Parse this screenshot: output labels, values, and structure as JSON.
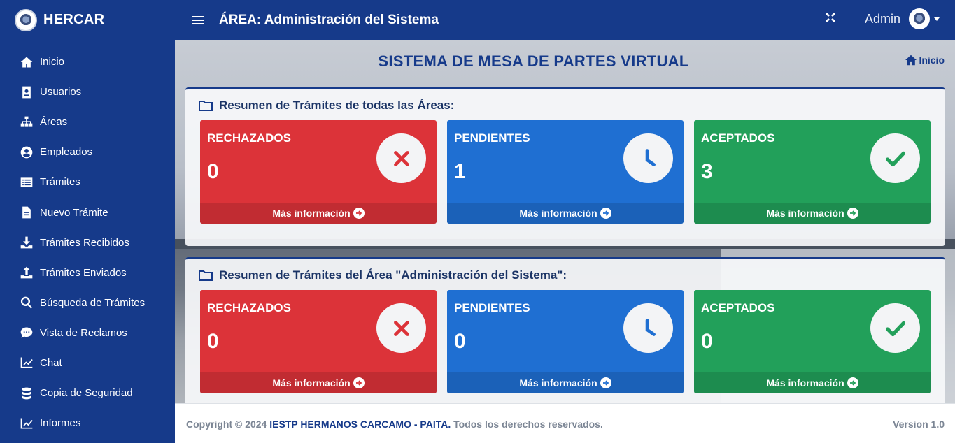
{
  "brand": {
    "name": "HERCAR"
  },
  "sidebar": {
    "items": [
      {
        "label": "Inicio",
        "icon": "home-icon"
      },
      {
        "label": "Usuarios",
        "icon": "id-badge-icon"
      },
      {
        "label": "Áreas",
        "icon": "sitemap-icon"
      },
      {
        "label": "Empleados",
        "icon": "user-circle-icon"
      },
      {
        "label": "Trámites",
        "icon": "list-icon"
      },
      {
        "label": "Nuevo Trámite",
        "icon": "file-icon"
      },
      {
        "label": "Trámites Recibidos",
        "icon": "download-icon"
      },
      {
        "label": "Trámites Enviados",
        "icon": "upload-icon"
      },
      {
        "label": "Búsqueda de Trámites",
        "icon": "search-icon"
      },
      {
        "label": "Vista de Reclamos",
        "icon": "comment-icon"
      },
      {
        "label": "Chat",
        "icon": "chart-line-icon"
      },
      {
        "label": "Copia de Seguridad",
        "icon": "database-icon"
      },
      {
        "label": "Informes",
        "icon": "chart-line-icon"
      }
    ]
  },
  "header": {
    "area_title": "ÁREA: Administración del Sistema",
    "user_name": "Admin"
  },
  "main": {
    "page_title": "SISTEMA DE MESA DE PARTES VIRTUAL",
    "breadcrumb": "Inicio",
    "summary_all": {
      "title": "Resumen de Trámites de todas las Áreas:",
      "rechazados": {
        "label": "RECHAZADOS",
        "value": "0",
        "more": "Más información"
      },
      "pendientes": {
        "label": "PENDIENTES",
        "value": "1",
        "more": "Más información"
      },
      "aceptados": {
        "label": "ACEPTADOS",
        "value": "3",
        "more": "Más información"
      }
    },
    "summary_area": {
      "title": "Resumen de Trámites del Área \"Administración del Sistema\":",
      "rechazados": {
        "label": "RECHAZADOS",
        "value": "0",
        "more": "Más información"
      },
      "pendientes": {
        "label": "PENDIENTES",
        "value": "0",
        "more": "Más información"
      },
      "aceptados": {
        "label": "ACEPTADOS",
        "value": "0",
        "more": "Más información"
      }
    }
  },
  "footer": {
    "copyright_prefix": "Copyright © 2024",
    "institution": "IESTP HERMANOS CARCAMO - PAITA.",
    "rights": "Todos los derechos reservados.",
    "version": "Version 1.0"
  },
  "colors": {
    "primary": "#163a8a",
    "danger": "#dc3339",
    "info": "#1f6fd2",
    "success": "#22a05a"
  }
}
